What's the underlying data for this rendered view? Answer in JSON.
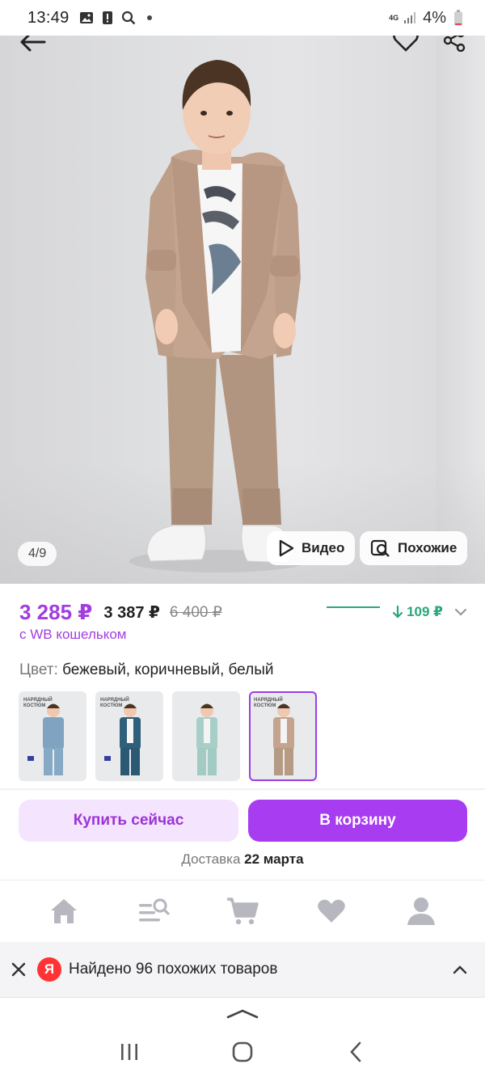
{
  "status_bar": {
    "time": "13:49",
    "network": "4G",
    "battery": "4%",
    "left_icons": [
      "image-icon",
      "alert-icon",
      "search-icon",
      "dot-icon"
    ],
    "right_icons": [
      "signal-icon",
      "battery-icon"
    ]
  },
  "product_gallery": {
    "pager": "4/9",
    "video_label": "Видео",
    "similar_label": "Похожие",
    "icons": [
      "back-arrow-icon",
      "heart-icon",
      "share-icon",
      "play-icon",
      "similar-search-icon"
    ]
  },
  "price": {
    "current": "3 285 ₽",
    "without_wallet": "3 387 ₽",
    "old": "6 400 ₽",
    "drop": "109 ₽",
    "wallet_note": "с WB кошельком",
    "colors": {
      "accent": "#a23de0",
      "drop": "#2aa87a"
    }
  },
  "color_selector": {
    "label": "Цвет:",
    "value": "бежевый, коричневый, белый",
    "thumb_tag": "НАРЯДНЫЙ КОСТЮМ",
    "selected_index": 3
  },
  "actions": {
    "buy_now": "Купить сейчас",
    "add_to_cart": "В корзину",
    "delivery_label": "Доставка",
    "delivery_date": "22 марта"
  },
  "bottom_nav": {
    "items": [
      "home-icon",
      "catalog-search-icon",
      "cart-icon",
      "favorites-heart-icon",
      "profile-icon"
    ]
  },
  "yandex_banner": {
    "logo": "Я",
    "text": "Найдено 96 похожих товаров"
  }
}
